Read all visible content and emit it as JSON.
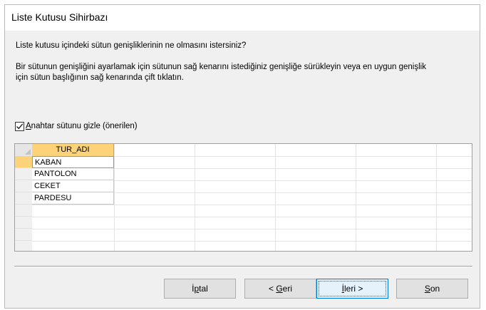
{
  "window": {
    "title": "Liste Kutusu Sihirbazı"
  },
  "instructions": {
    "question": "Liste kutusu içindeki sütun genişliklerinin ne olmasını istersiniz?",
    "line1": "Bir sütunun genişliğini ayarlamak için sütunun sağ kenarını istediğiniz genişliğe sürükleyin veya en uygun genişlik",
    "line2": "için sütun başlığının sağ kenarında çift tıklatın."
  },
  "hide_key": {
    "checked": true,
    "label_mnemonic": "A",
    "label_rest": "nahtar sütunu gizle (önerilen)"
  },
  "grid": {
    "column": "TUR_ADI",
    "rows": [
      "KABAN",
      "PANTOLON",
      "CEKET",
      "PARDESU"
    ],
    "active_row": 0
  },
  "buttons": {
    "cancel": {
      "pre": "İ",
      "mn": "p",
      "post": "tal"
    },
    "back": {
      "pre": "< ",
      "mn": "G",
      "post": "eri"
    },
    "next": {
      "pre": "",
      "mn": "İ",
      "post": "leri >"
    },
    "finish": {
      "pre": "",
      "mn": "S",
      "post": "on"
    }
  },
  "colors": {
    "header": "#fcd378",
    "accent": "#0078d7"
  }
}
